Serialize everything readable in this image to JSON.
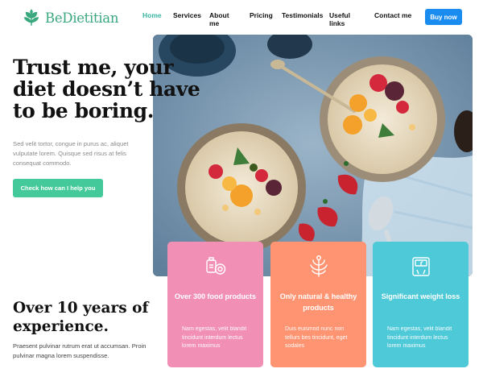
{
  "brand": {
    "name": "BeDietitian",
    "accent": "#3aa87f"
  },
  "nav": {
    "items": [
      {
        "label": "Home",
        "active": true
      },
      {
        "label": "Services",
        "active": false
      },
      {
        "label": "About me",
        "active": false
      },
      {
        "label": "Pricing",
        "active": false
      },
      {
        "label": "Testimonials",
        "active": false
      },
      {
        "label": "Useful links",
        "active": false
      },
      {
        "label": "Contact me",
        "active": false
      }
    ],
    "buy_label": "Buy now"
  },
  "hero": {
    "title": "Trust me, your diet doesn’t have to be boring.",
    "subtitle": "Sed velit tortor, congue in purus ac, aliquet vulputate lorem. Quisque sed risus at felis consequat commodo.",
    "cta_label": "Check how can I help you"
  },
  "experience": {
    "title": "Over 10 years of experience.",
    "text": "Praesent pulvinar rutrum erat ut accumsan. Proin pulvinar magna lorem suspendisse."
  },
  "cards": [
    {
      "icon": "food-scale-icon",
      "title": "Over 300 food products",
      "text": "Nam egestas, velit blandit tincidunt interdum lectus lorem maximus",
      "color": "#f18fb4"
    },
    {
      "icon": "leaf-icon",
      "title": "Only natural & healthy products",
      "text": "Duis euismod nunc non tellurs bes tincidunt, eget sodales",
      "color": "#ff9472"
    },
    {
      "icon": "body-scale-icon",
      "title": "Significant weight loss",
      "text": "Nam egestas, velit blandit tincidunt interdum lectus lorem maximus",
      "color": "#4ec9d8"
    }
  ]
}
